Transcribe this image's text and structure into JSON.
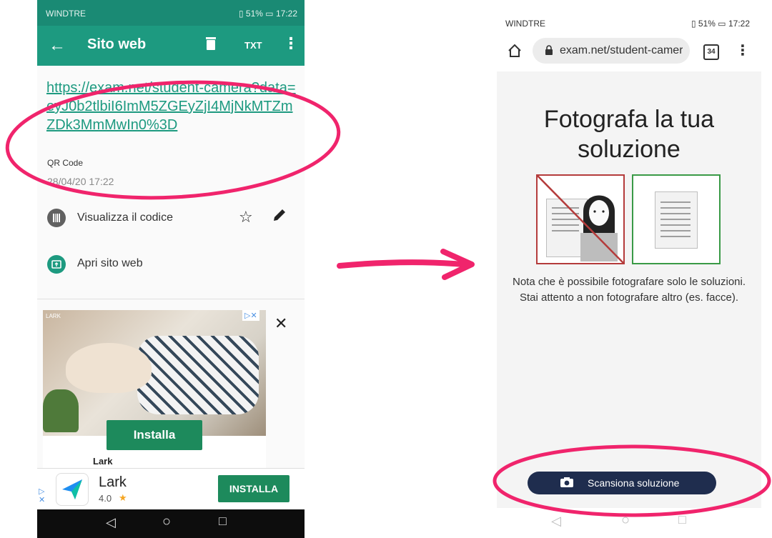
{
  "left_phone": {
    "status_bar": {
      "carrier": "WINDTRE",
      "battery": "51%",
      "time": "17:22"
    },
    "toolbar": {
      "title": "Sito web",
      "back_icon": "arrow-left-icon",
      "delete_icon": "trash-icon",
      "txt_label": "TXT",
      "more_icon": "more-vert-icon"
    },
    "result": {
      "url": "https://exam.net/student-camera?data=eyJ0b2tlbiI6ImM5ZGEyZjI4MjNkMTZmZDk3MmMwIn0%3D",
      "type": "QR Code",
      "date": "28/04/20 17:22"
    },
    "actions": [
      {
        "label": "Visualizza il codice",
        "icon": "barcode-icon"
      },
      {
        "label": "Apri sito web",
        "icon": "open-web-icon"
      }
    ],
    "ad": {
      "brand_small": "LARK",
      "install_label": "Installa",
      "app_name": "Lark"
    },
    "banner": {
      "app_name": "Lark",
      "rating": "4.0",
      "install_label": "INSTALLA"
    }
  },
  "right_phone": {
    "status_bar": {
      "carrier": "WINDTRE",
      "battery": "51%",
      "time": "17:22"
    },
    "address_bar": {
      "url": "exam.net/student-camera",
      "tab_count": "34"
    },
    "headline": "Fotografa la tua soluzione",
    "note": "Nota che è possibile fotografare solo le soluzioni. Stai attento a non fotografare altro (es. facce).",
    "scan_button": "Scansiona soluzione"
  },
  "colors": {
    "accent_green": "#1d9a80",
    "annotation_pink": "#f0246c",
    "wrong_red": "#b43b3b",
    "right_green": "#3a9a46",
    "scan_navy": "#1f2d4e"
  }
}
